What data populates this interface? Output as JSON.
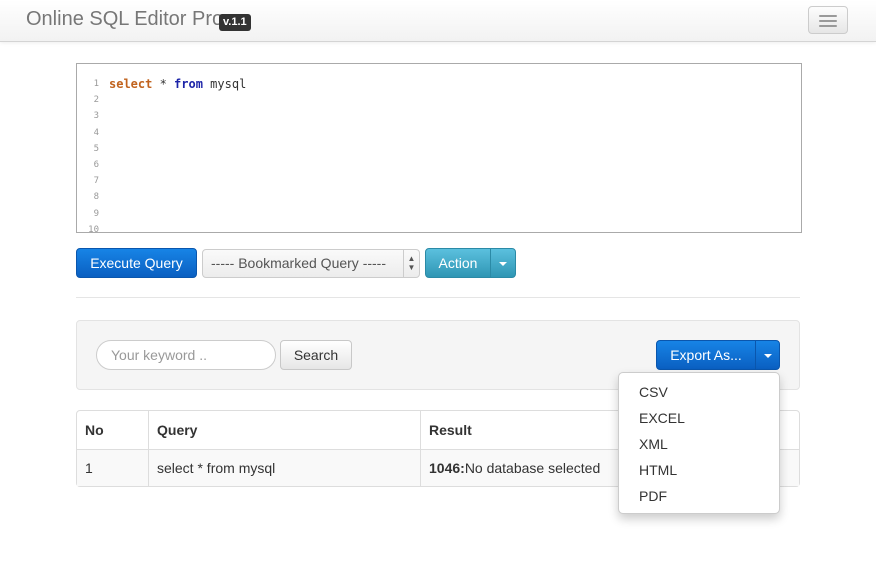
{
  "header": {
    "brand": "Online SQL Editor Pro",
    "version": "v.1.1"
  },
  "editor": {
    "line_numbers": [
      "1",
      "2",
      "3",
      "4",
      "5",
      "6",
      "7",
      "8",
      "9",
      "10"
    ],
    "code": {
      "kw_select": "select",
      "star": " * ",
      "kw_from": "from",
      "table": " mysql"
    }
  },
  "toolbar": {
    "execute_label": "Execute Query",
    "bookmark_select": "----- Bookmarked Query -----",
    "action_label": "Action"
  },
  "search": {
    "placeholder": "Your keyword ..",
    "button_label": "Search",
    "export_label": "Export As..."
  },
  "export_menu": [
    "CSV",
    "EXCEL",
    "XML",
    "HTML",
    "PDF"
  ],
  "table": {
    "headers": [
      "No",
      "Query",
      "Result"
    ],
    "rows": [
      {
        "no": "1",
        "query": "select * from mysql",
        "result_code": "1046:",
        "result_text": "No database selected"
      }
    ]
  }
}
